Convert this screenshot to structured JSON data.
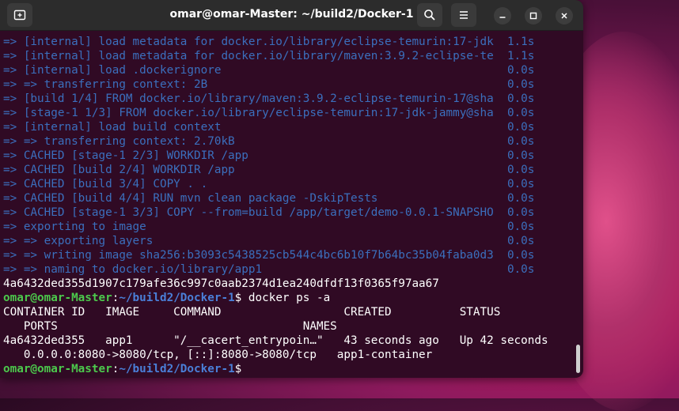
{
  "window": {
    "title": "omar@omar-Master: ~/build2/Docker-1"
  },
  "icons": [
    "new-tab-icon",
    "search-icon",
    "menu-icon",
    "minimize-icon",
    "maximize-icon",
    "close-icon"
  ],
  "build_lines": [
    "=> [internal] load metadata for docker.io/library/eclipse-temurin:17-jdk  1.1s",
    "=> [internal] load metadata for docker.io/library/maven:3.9.2-eclipse-te  1.1s",
    "=> [internal] load .dockerignore                                          0.0s",
    "=> => transferring context: 2B                                            0.0s",
    "=> [build 1/4] FROM docker.io/library/maven:3.9.2-eclipse-temurin-17@sha  0.0s",
    "=> [stage-1 1/3] FROM docker.io/library/eclipse-temurin:17-jdk-jammy@sha  0.0s",
    "=> [internal] load build context                                          0.0s",
    "=> => transferring context: 2.70kB                                        0.0s",
    "=> CACHED [stage-1 2/3] WORKDIR /app                                      0.0s",
    "=> CACHED [build 2/4] WORKDIR /app                                        0.0s",
    "=> CACHED [build 3/4] COPY . .                                            0.0s",
    "=> CACHED [build 4/4] RUN mvn clean package -DskipTests                   0.0s",
    "=> CACHED [stage-1 3/3] COPY --from=build /app/target/demo-0.0.1-SNAPSHO  0.0s",
    "=> exporting to image                                                     0.0s",
    "=> => exporting layers                                                    0.0s",
    "=> => writing image sha256:b3093c5438525cb544c4bc6b10f7b64bc35b04faba0d3  0.0s",
    "=> => naming to docker.io/library/app1                                    0.0s"
  ],
  "image_hash": "4a6432ded355d1907c179afe36c997c0aab2374d1ea240dfdf13f0365f97aa67",
  "prompt": {
    "user_host": "omar@omar-Master",
    "colon": ":",
    "path": "~/build2/Docker-1",
    "dollar": "$",
    "command": " docker ps -a"
  },
  "ps_output": [
    "CONTAINER ID   IMAGE     COMMAND                  CREATED          STATUS",
    "   PORTS                                    NAMES",
    "4a6432ded355   app1      \"/__cacert_entrypoin…\"   43 seconds ago   Up 42 seconds",
    "   0.0.0.0:8080->8080/tcp, [::]:8080->8080/tcp   app1-container"
  ],
  "final_prompt": {
    "user_host": "omar@omar-Master",
    "colon": ":",
    "path": "~/build2/Docker-1",
    "dollar": "$"
  }
}
